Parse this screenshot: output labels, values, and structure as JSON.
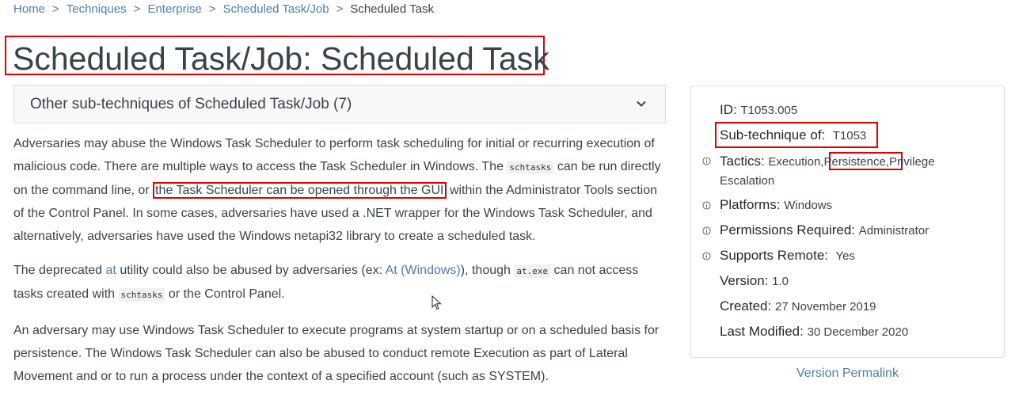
{
  "breadcrumb": {
    "items": [
      "Home",
      "Techniques",
      "Enterprise",
      "Scheduled Task/Job"
    ],
    "current": "Scheduled Task",
    "separator": ">"
  },
  "title": "Scheduled Task/Job: Scheduled Task",
  "accordion": {
    "label": "Other sub-techniques of Scheduled Task/Job (7)",
    "icon": "chevron-down-icon"
  },
  "body": {
    "p1": {
      "t1": "Adversaries may abuse the Windows Task Scheduler to perform task scheduling for initial or recurring execution of malicious code. There are multiple ways to access the Task Scheduler in Windows. The ",
      "code1": "schtasks",
      "t2": " can be run directly on the command line, or ",
      "highlight": "the Task Scheduler can be opened through the GUI",
      "t3": " within the Administrator Tools section of the Control Panel. In some cases, adversaries have used a .NET wrapper for the Windows Task Scheduler, and alternatively, adversaries have used the Windows netapi32 library to create a scheduled task."
    },
    "p2": {
      "t1": "The deprecated ",
      "link1": "at",
      "t2": " utility could also be abused by adversaries (ex: ",
      "link2": "At (Windows)",
      "t3": "), though ",
      "code1": "at.exe",
      "t4": " can not access tasks created with ",
      "code2": "schtasks",
      "t5": " or the Control Panel."
    },
    "p3": "An adversary may use Windows Task Scheduler to execute programs at system startup or on a scheduled basis for persistence. The Windows Task Scheduler can also be abused to conduct remote Execution as part of Lateral Movement and or to run a process under the context of a specified account (such as SYSTEM)."
  },
  "card": {
    "id_label": "ID:",
    "id_value": "T1053.005",
    "subtech_label": "Sub-technique of:",
    "subtech_value": "T1053",
    "tactics_label": "Tactics:",
    "tactic1": "Execution",
    "tactic2": "Persistence",
    "tactic3a": "Privilege",
    "tactic3b": "Escalation",
    "platforms_label": "Platforms:",
    "platforms_value": "Windows",
    "permissions_label": "Permissions Required:",
    "permissions_value": "Administrator",
    "remote_label": "Supports Remote:",
    "remote_value": "Yes",
    "version_label": "Version:",
    "version_value": "1.0",
    "created_label": "Created:",
    "created_value": "27 November 2019",
    "modified_label": "Last Modified:",
    "modified_value": "30 December 2020"
  },
  "permalink": "Version Permalink"
}
